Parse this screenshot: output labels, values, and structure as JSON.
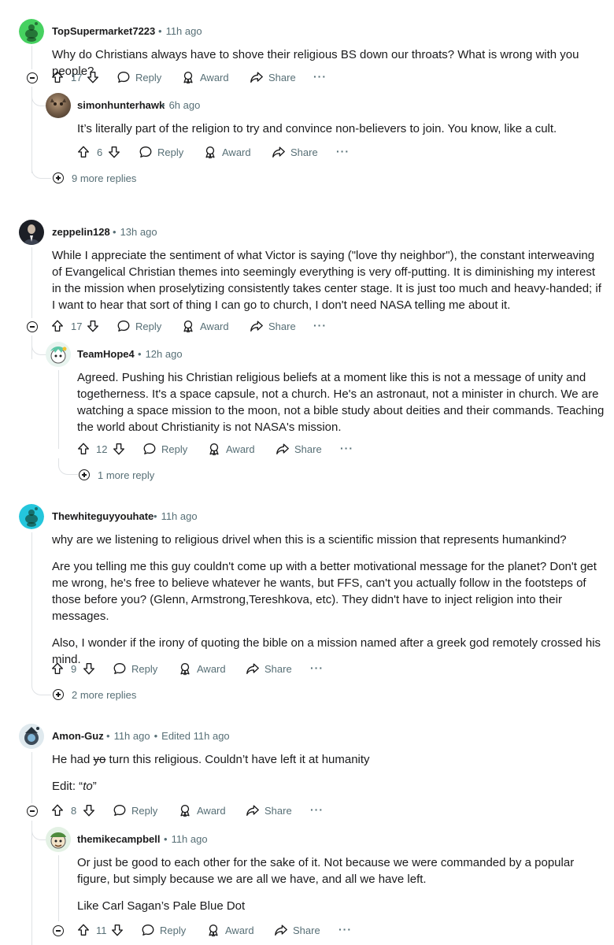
{
  "labels": {
    "reply": "Reply",
    "award": "Award",
    "share": "Share",
    "more": "···"
  },
  "comments": [
    {
      "user": "TopSupermarket7223",
      "time": "11h ago",
      "text": "Why do Christians always have to shove their religious BS down our throats? What is wrong with you people?",
      "votes": "17",
      "replies": [
        {
          "user": "simonhunterhawk",
          "time": "6h ago",
          "text": "It’s literally part of the religion to try and convince non-believers to join. You know, like a cult.",
          "votes": "6"
        }
      ],
      "more_replies": "9 more replies"
    },
    {
      "user": "zeppelin128",
      "time": "13h ago",
      "text": "While I appreciate the sentiment of what Victor is saying (\"love thy neighbor\"), the constant interweaving of Evangelical Christian themes into seemingly everything is very off-putting. It is diminishing my interest in the mission when proselytizing consistently takes center stage. It is just too much and heavy-handed; if I want to hear that sort of thing I can go to church, I don't need NASA telling me about it.",
      "votes": "17",
      "replies": [
        {
          "user": "TeamHope4",
          "time": "12h ago",
          "text": "Agreed. Pushing his Christian religious beliefs at a moment like this is not a message of unity and togetherness. It's a space capsule, not a church. He's an astronaut, not a minister in church. We are watching a space mission to the moon, not a bible study about deities and their commands. Teaching the world about Christianity is not NASA's mission.",
          "votes": "12",
          "more_replies": "1 more reply"
        }
      ]
    },
    {
      "user": "Thewhiteguyyouhate",
      "time": "11h ago",
      "paragraphs": [
        "why are we listening to religious drivel when this is a scientific mission that represents humankind?",
        "Are you telling me this guy couldn't come up with a better motivational message for the planet? Don't get me wrong, he's free to believe whatever he wants, but FFS, can't you actually follow in the footsteps of those before you? (Glenn, Armstrong,Tereshkova, etc). They didn't have to inject religion into their messages.",
        "Also, I wonder if the irony of quoting the bible on a mission named after a greek god remotely crossed his mind."
      ],
      "votes": "9",
      "more_replies": "2 more replies"
    },
    {
      "user": "Amon-Guz",
      "time": "11h ago",
      "edited": "Edited 11h ago",
      "text_before": "He had ",
      "text_struck": "yo",
      "text_after": " turn this religious. Couldn’t have left it at humanity",
      "edit_prefix": "Edit: “",
      "edit_word": "to",
      "edit_suffix": "”",
      "votes": "8",
      "replies": [
        {
          "user": "themikecampbell",
          "time": "11h ago",
          "paragraphs": [
            "Or just be good to each other for the sake of it. Not because we were commanded by a popular figure, but simply because we are all we have, and all we have left.",
            "Like Carl Sagan’s Pale Blue Dot"
          ],
          "votes": "11"
        }
      ]
    }
  ],
  "colors": {
    "text": "#1a1a1b",
    "meta": "#576f76",
    "thread_line": "#dfe2e5",
    "snoo_green": "#46d160",
    "snoo_cyan": "#24c6dc"
  }
}
